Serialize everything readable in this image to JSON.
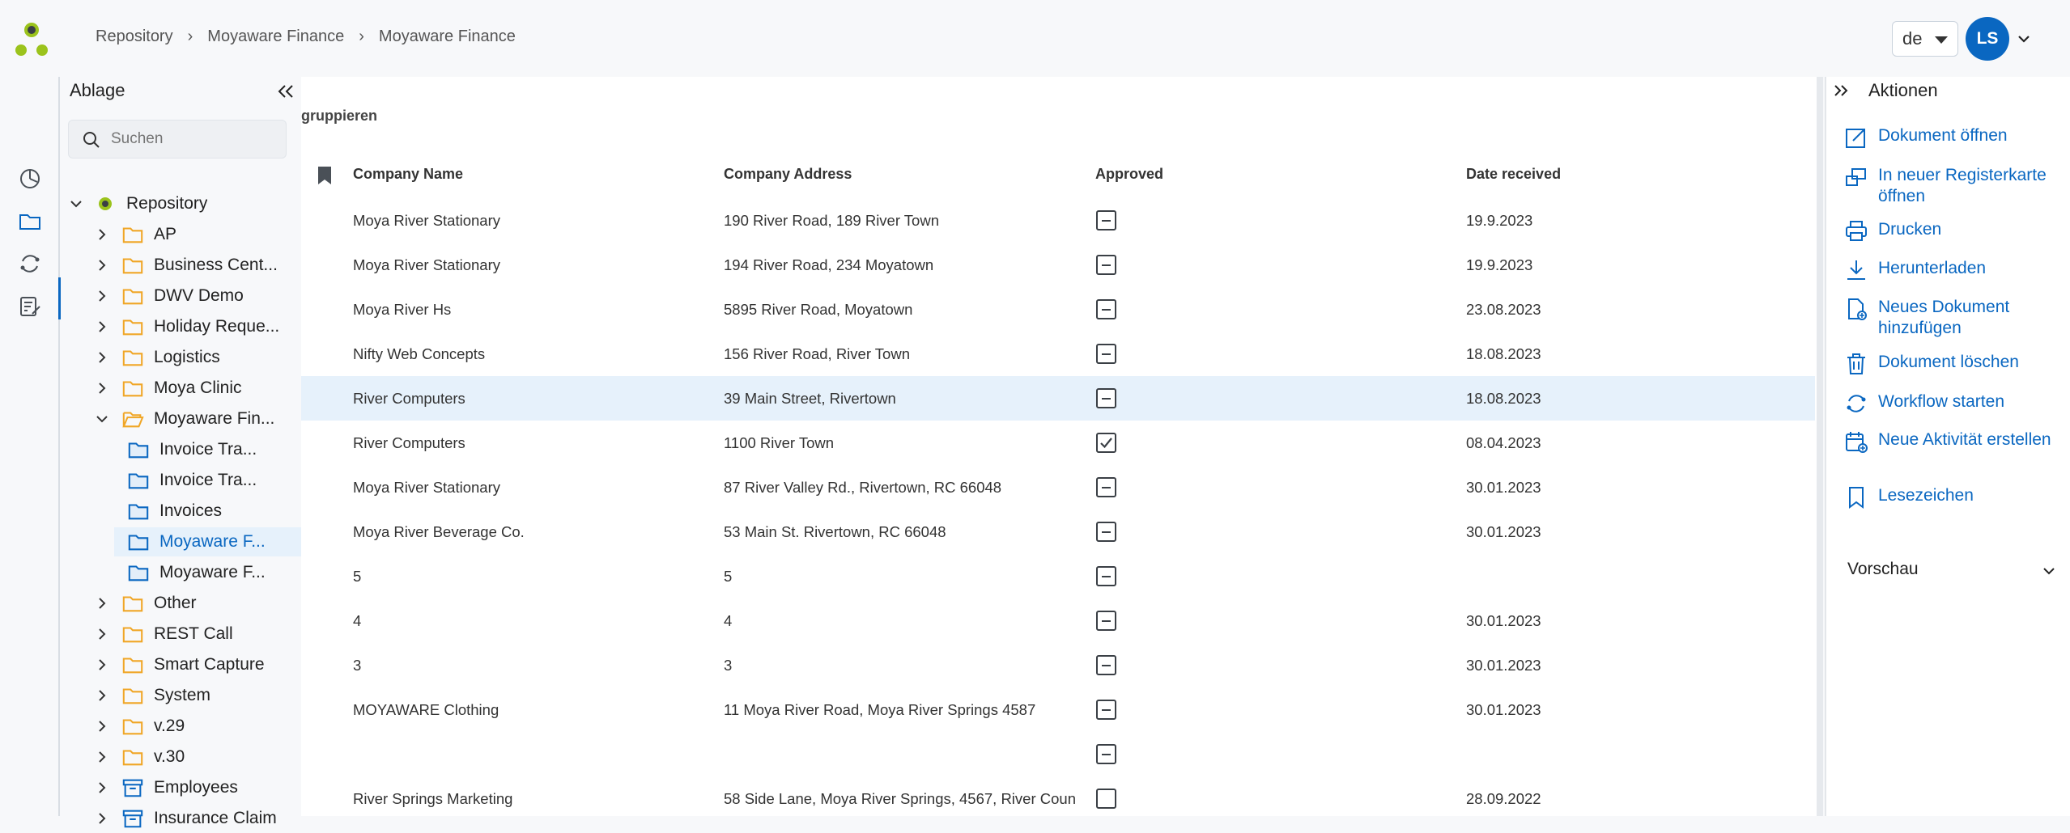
{
  "app": {
    "breadcrumbs": [
      "Repository",
      "Moyaware Finance",
      "Moyaware Finance"
    ],
    "language": "de",
    "user_initials": "LS",
    "accent_color": "#0a67c1",
    "folder_color": "#f0a626"
  },
  "rail": {
    "icons": [
      "dashboard-icon",
      "folder-icon",
      "workflow-icon",
      "tasks-icon"
    ],
    "active": "folder-icon"
  },
  "sidebar": {
    "title": "Ablage",
    "search_placeholder": "Suchen",
    "tree": [
      {
        "label": "Repository",
        "level": 0,
        "type": "repository",
        "expanded": true
      },
      {
        "label": "AP",
        "level": 1,
        "type": "folder"
      },
      {
        "label": "Business Cent...",
        "level": 1,
        "type": "folder"
      },
      {
        "label": "DWV Demo",
        "level": 1,
        "type": "folder"
      },
      {
        "label": "Holiday Reque...",
        "level": 1,
        "type": "folder"
      },
      {
        "label": "Logistics",
        "level": 1,
        "type": "folder"
      },
      {
        "label": "Moya Clinic",
        "level": 1,
        "type": "folder"
      },
      {
        "label": "Moyaware Fin...",
        "level": 1,
        "type": "folder-open",
        "expanded": true
      },
      {
        "label": "Invoice Tra...",
        "level": 2,
        "type": "view"
      },
      {
        "label": "Invoice Tra...",
        "level": 2,
        "type": "view"
      },
      {
        "label": "Invoices",
        "level": 2,
        "type": "view"
      },
      {
        "label": "Moyaware F...",
        "level": 2,
        "type": "view",
        "selected": true
      },
      {
        "label": "Moyaware F...",
        "level": 2,
        "type": "view"
      },
      {
        "label": "Other",
        "level": 1,
        "type": "folder"
      },
      {
        "label": "REST Call",
        "level": 1,
        "type": "folder"
      },
      {
        "label": "Smart Capture",
        "level": 1,
        "type": "folder"
      },
      {
        "label": "System",
        "level": 1,
        "type": "folder"
      },
      {
        "label": "v.29",
        "level": 1,
        "type": "folder"
      },
      {
        "label": "v.30",
        "level": 1,
        "type": "folder"
      },
      {
        "label": "Employees",
        "level": 1,
        "type": "archive"
      },
      {
        "label": "Insurance Claim",
        "level": 1,
        "type": "archive"
      }
    ]
  },
  "main": {
    "group_label": "gruppieren",
    "columns": [
      "Company Name",
      "Company Address",
      "Approved",
      "Date received"
    ],
    "rows": [
      {
        "name": "Moya River Stationary",
        "address": "190 River Road, 189 River Town",
        "approved": "indeterminate",
        "date": "19.9.2023"
      },
      {
        "name": "Moya River Stationary",
        "address": "194 River Road, 234 Moyatown",
        "approved": "indeterminate",
        "date": "19.9.2023"
      },
      {
        "name": "Moya River Hs",
        "address": "5895 River Road, Moyatown",
        "approved": "indeterminate",
        "date": "23.08.2023"
      },
      {
        "name": "Nifty Web Concepts",
        "address": "156 River Road, River Town",
        "approved": "indeterminate",
        "date": "18.08.2023"
      },
      {
        "name": "River Computers",
        "address": "39 Main Street, Rivertown",
        "approved": "indeterminate",
        "date": "18.08.2023",
        "selected": true
      },
      {
        "name": "River Computers",
        "address": "1100 River Town",
        "approved": "checked",
        "date": "08.04.2023"
      },
      {
        "name": "Moya River Stationary",
        "address": "87 River Valley Rd., Rivertown, RC 66048",
        "approved": "indeterminate",
        "date": "30.01.2023"
      },
      {
        "name": "Moya River Beverage Co.",
        "address": "53 Main St. Rivertown, RC 66048",
        "approved": "indeterminate",
        "date": "30.01.2023"
      },
      {
        "name": "5",
        "address": "5",
        "approved": "indeterminate",
        "date": ""
      },
      {
        "name": "4",
        "address": "4",
        "approved": "indeterminate",
        "date": "30.01.2023"
      },
      {
        "name": "3",
        "address": "3",
        "approved": "indeterminate",
        "date": "30.01.2023"
      },
      {
        "name": "MOYAWARE Clothing",
        "address": "11 Moya River Road, Moya River Springs 4587",
        "approved": "indeterminate",
        "date": "30.01.2023"
      },
      {
        "name": "",
        "address": "",
        "approved": "indeterminate",
        "date": ""
      },
      {
        "name": "River Springs Marketing",
        "address": "58 Side Lane, Moya River Springs, 4567, River Coun",
        "approved": "unchecked",
        "date": "28.09.2022"
      }
    ]
  },
  "actions": {
    "title": "Aktionen",
    "items": [
      {
        "label": "Dokument öffnen",
        "icon": "open-external-icon"
      },
      {
        "label": "In neuer Registerkarte öffnen",
        "icon": "new-tab-icon"
      },
      {
        "label": "Drucken",
        "icon": "print-icon"
      },
      {
        "label": "Herunterladen",
        "icon": "download-icon"
      },
      {
        "label": "Neues Dokument hinzufügen",
        "icon": "add-document-icon"
      },
      {
        "label": "Dokument löschen",
        "icon": "trash-icon"
      },
      {
        "label": "Workflow starten",
        "icon": "workflow-icon"
      },
      {
        "label": "Neue Aktivität erstellen",
        "icon": "new-activity-icon"
      },
      {
        "label": "Lesezeichen",
        "icon": "bookmark-icon"
      }
    ],
    "preview_label": "Vorschau"
  }
}
